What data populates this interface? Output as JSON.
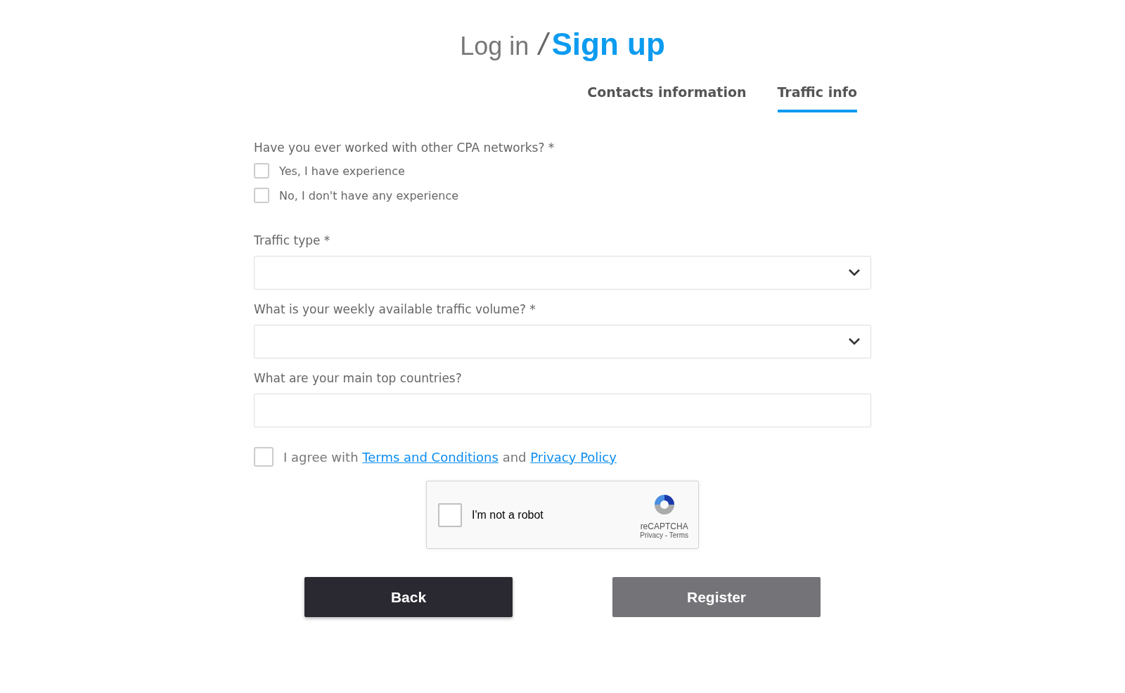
{
  "header": {
    "login": "Log in",
    "separator": "/",
    "signup": "Sign up"
  },
  "tabs": [
    {
      "label": "Contacts information",
      "selected": false
    },
    {
      "label": "Traffic info",
      "selected": true
    }
  ],
  "experience": {
    "question": "Have you ever worked with other CPA networks? *",
    "options": [
      {
        "label": "Yes, I have experience",
        "checked": false
      },
      {
        "label": "No, I don't have any experience",
        "checked": false
      }
    ]
  },
  "fields": [
    {
      "kind": "select",
      "label": "Traffic type *"
    },
    {
      "kind": "select",
      "label": "What is your weekly available traffic volume? *"
    },
    {
      "kind": "text",
      "label": "What are your main top countries?"
    }
  ],
  "agreement": {
    "checked": false,
    "text": "I agree with",
    "terms_link": "Terms and Conditions",
    "joiner": "and",
    "privacy_link": "Privacy Policy"
  },
  "captcha": {
    "checked": false,
    "label": "I'm not a robot",
    "brand": "reCAPTCHA",
    "links": "Privacy - Terms"
  },
  "buttons": [
    {
      "label": "Back",
      "disabled": false
    },
    {
      "label": "Register",
      "disabled": true
    }
  ]
}
